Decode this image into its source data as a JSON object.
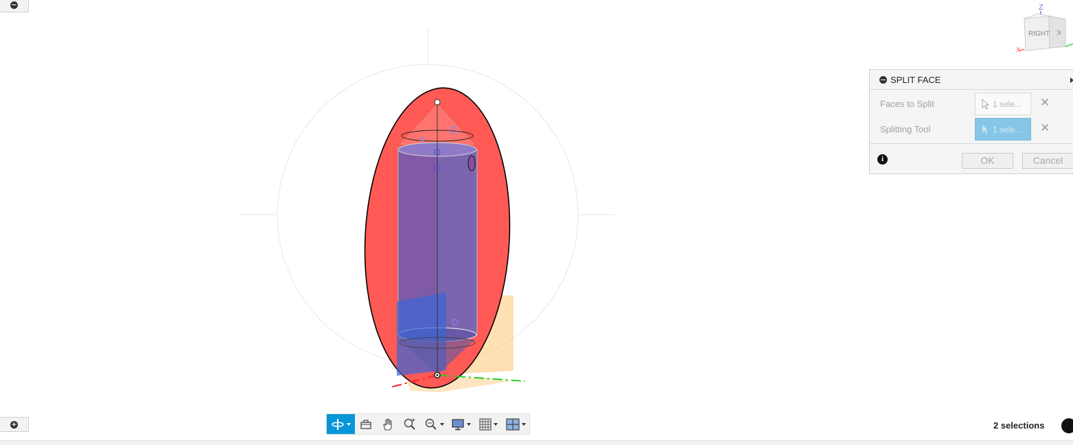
{
  "canvas": {
    "collapse_icon": "minus-circle-icon",
    "expand_icon": "plus-circle-icon",
    "colors": {
      "outer_ellipse": "#ff5a55",
      "cylinder": "#7466b3",
      "plane_blue": "#3a65d4",
      "plane_orange": "#ffcc80",
      "axis_red": "#ff2020",
      "axis_green": "#22cc22"
    }
  },
  "viewcube": {
    "face_label": "RIGHT",
    "axis_z": "Z",
    "axis_x": "X"
  },
  "split_face": {
    "title": "SPLIT FACE",
    "faces_to_split": {
      "label": "Faces to Split",
      "value": "1 sele..."
    },
    "splitting_tool": {
      "label": "Splitting Tool",
      "value": "1 sele..."
    },
    "ok_label": "OK",
    "cancel_label": "Cancel",
    "accent": "#87c6e6"
  },
  "nav_toolbar": {
    "items": [
      "orbit-icon",
      "look-at-icon",
      "pan-icon",
      "zoom-icon",
      "fit-icon",
      "display-settings-icon",
      "grid-icon",
      "viewports-icon"
    ],
    "active_color": "#0696d7"
  },
  "status": {
    "selection_text": "2 selections"
  }
}
